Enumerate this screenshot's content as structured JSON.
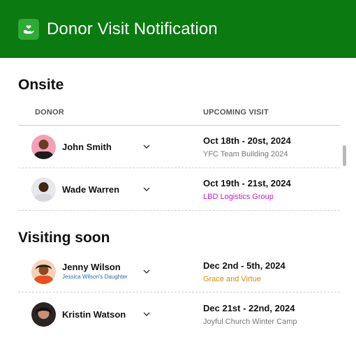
{
  "header": {
    "title": "Donor Visit Notification",
    "icon": "hand-heart-icon"
  },
  "onsite": {
    "title": "Onsite",
    "columns": {
      "donor": "DONOR",
      "visit": "UPCOMING VISIT"
    },
    "rows": [
      {
        "name": "John Smith",
        "date": "Oct 18th - 20st, 2024",
        "event": "YFC Team Building 2024",
        "event_color": "#777777"
      },
      {
        "name": "Wade Warren",
        "date": "Oct 19th - 21st, 2024",
        "event": "LBD Logistics Group",
        "event_color": "#c41bc4"
      }
    ]
  },
  "soon": {
    "title": "Visiting soon",
    "rows": [
      {
        "name": "Jenny Wilson",
        "subtitle": "Jessica Wilson's Daughter",
        "date": "Dec 2nd - 5th, 2024",
        "event": "Grace and Virtue",
        "event_color": "#d98a00"
      },
      {
        "name": "Kristin Watson",
        "date": "Dec 21st - 22nd, 2024",
        "event": "Joyful Church Winter Camp",
        "event_color": "#777777"
      }
    ]
  },
  "colors": {
    "header_bg": "#0b7a10",
    "logo_bg": "#2eaa35"
  }
}
